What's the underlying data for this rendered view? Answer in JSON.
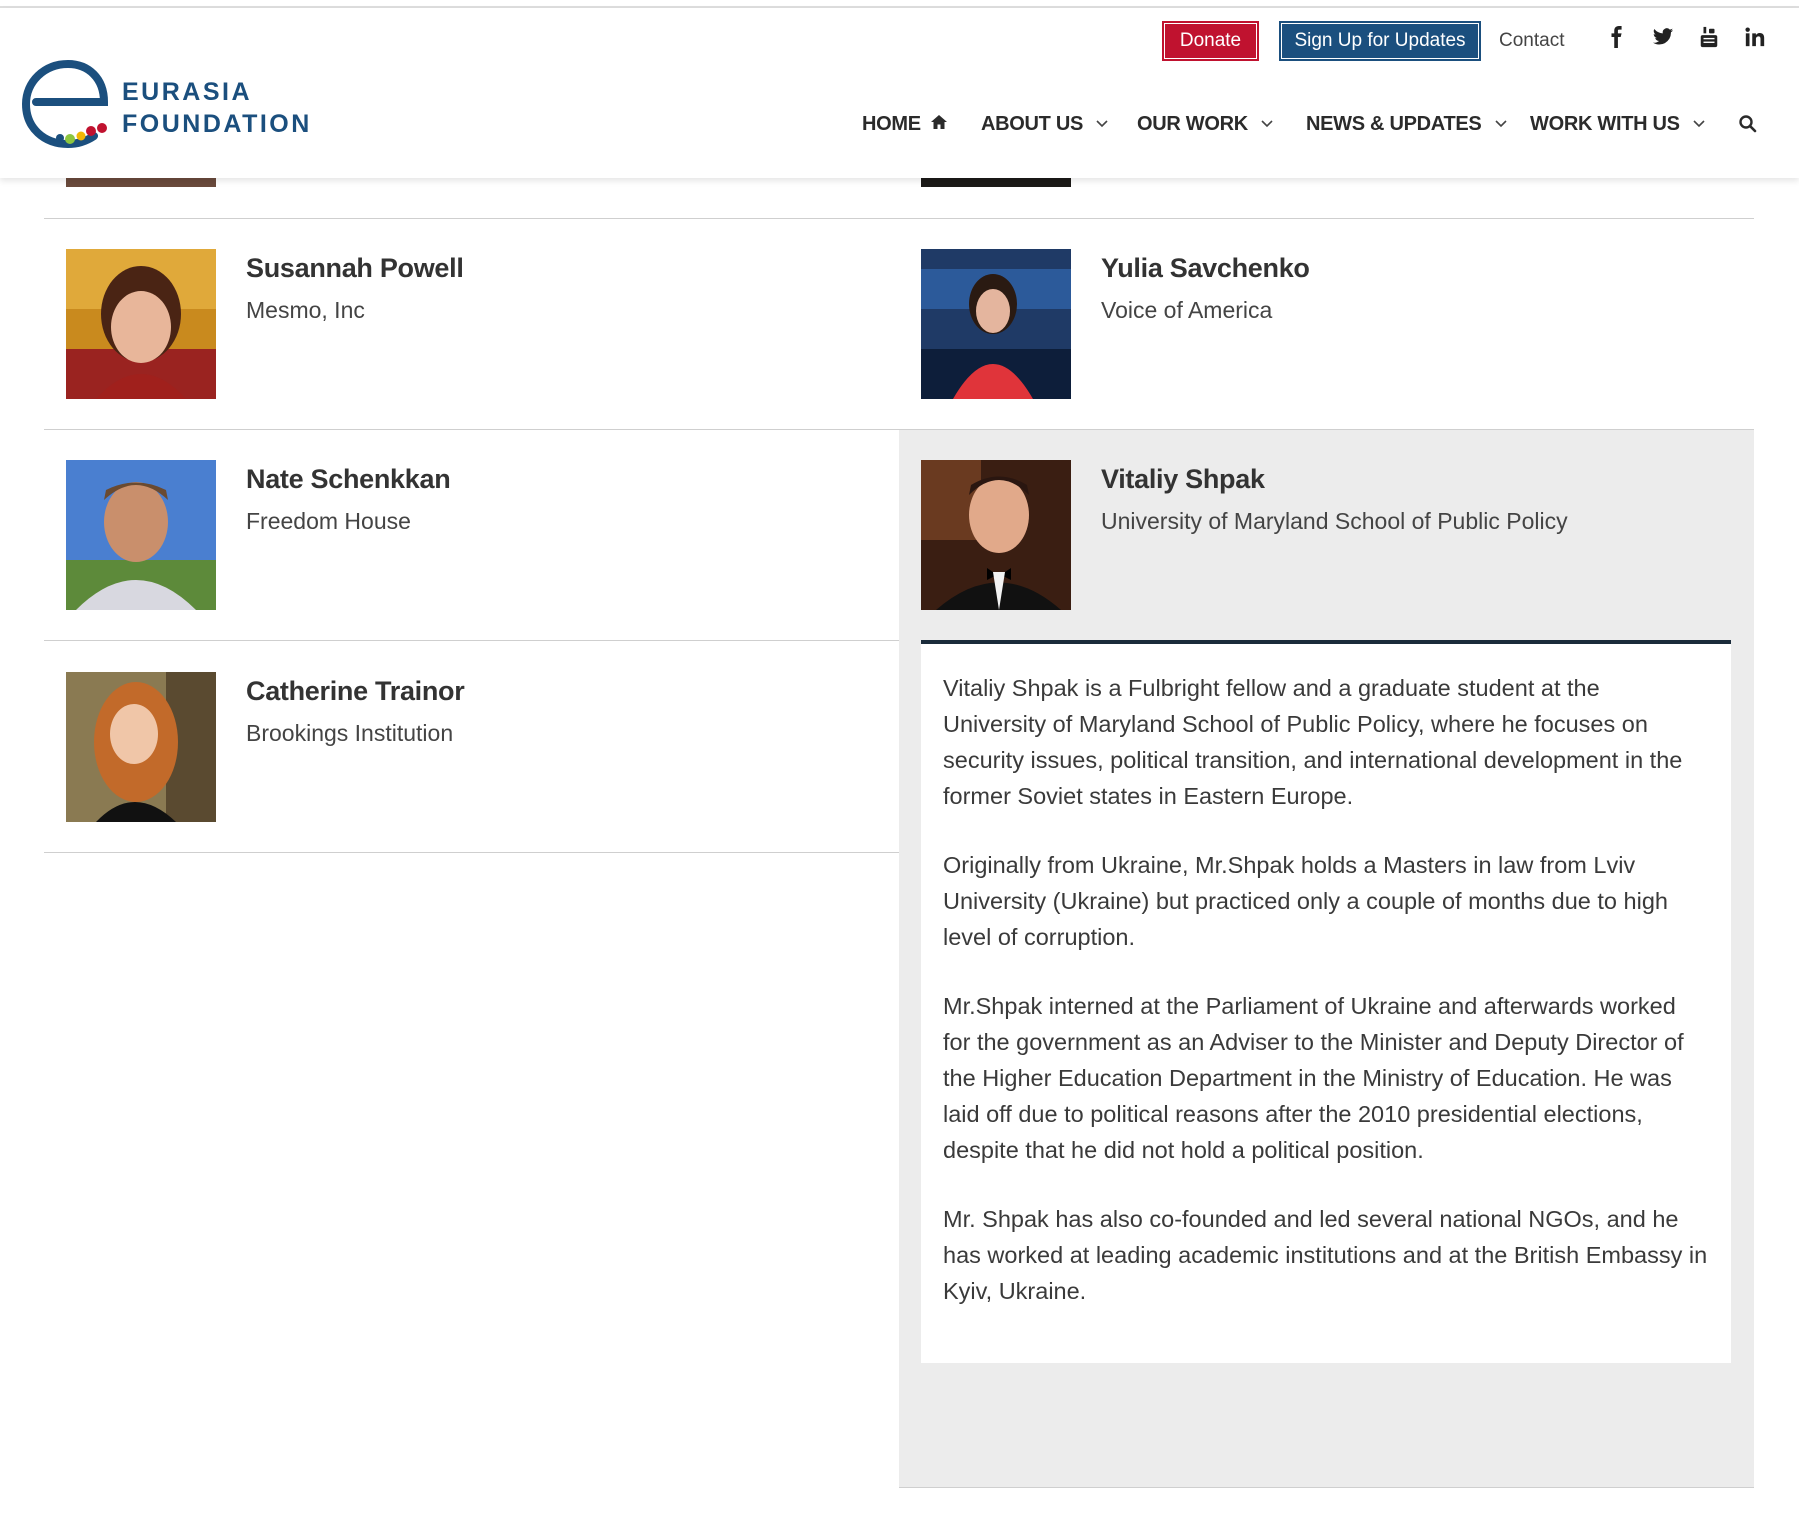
{
  "brand": {
    "line1": "EURASIA",
    "line2": "FOUNDATION"
  },
  "utility": {
    "donate_label": "Donate",
    "signup_label": "Sign Up for Updates",
    "contact_label": "Contact",
    "social": [
      "facebook-icon",
      "twitter-icon",
      "youtube-icon",
      "linkedin-icon"
    ]
  },
  "nav": {
    "items": [
      {
        "label": "HOME",
        "icon": "home-icon"
      },
      {
        "label": "ABOUT US",
        "icon": "chevron-down-icon"
      },
      {
        "label": "OUR WORK",
        "icon": "chevron-down-icon"
      },
      {
        "label": "NEWS & UPDATES",
        "icon": "chevron-down-icon"
      },
      {
        "label": "WORK WITH US",
        "icon": "chevron-down-icon"
      }
    ],
    "search_icon": "search-icon"
  },
  "colors": {
    "brand_blue": "#1b4f7e",
    "donate_red": "#c0122f",
    "active_bg": "#ececec",
    "bio_border": "#1a2b3a"
  },
  "people": [
    {
      "name": "Susannah Powell",
      "org": "Mesmo, Inc"
    },
    {
      "name": "Yulia Savchenko",
      "org": "Voice of America"
    },
    {
      "name": "Nate Schenkkan",
      "org": "Freedom House"
    },
    {
      "name": "Vitaliy Shpak",
      "org": "University of Maryland School of Public Policy"
    },
    {
      "name": "Catherine Trainor",
      "org": "Brookings Institution"
    }
  ],
  "bio": {
    "paragraphs": [
      "Vitaliy Shpak is a Fulbright fellow and a graduate student at the University of Maryland School of Public Policy, where he focuses on security issues, political transition, and international development in the former Soviet states in Eastern Europe.",
      "Originally from Ukraine, Mr.Shpak holds a Masters in law from Lviv University (Ukraine) but practiced only a couple of months due to high level of corruption.",
      "Mr.Shpak interned at the Parliament of Ukraine and afterwards worked for the government as an Adviser to the Minister and Deputy Director of the Higher Education Department in the Ministry of Education. He was laid off due to political reasons after the 2010 presidential elections, despite that he did not hold a political position.",
      "Mr. Shpak has also co-founded and led several national NGOs, and he has worked at leading academic institutions and at the British Embassy in Kyiv, Ukraine."
    ]
  }
}
